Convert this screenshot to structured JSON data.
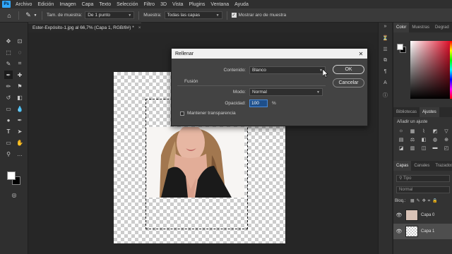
{
  "menubar": {
    "logo": "Ps",
    "items": [
      "Archivo",
      "Edición",
      "Imagen",
      "Capa",
      "Texto",
      "Selección",
      "Filtro",
      "3D",
      "Vista",
      "Plugins",
      "Ventana",
      "Ayuda"
    ]
  },
  "options": {
    "sample_size_label": "Tam. de muestra:",
    "sample_size_value": "De 1 punto",
    "sample_label": "Muestra:",
    "sample_value": "Todas las capas",
    "show_ring_label": "Mostrar aro de muestra",
    "show_ring_checked": true
  },
  "document": {
    "tab_title": "Ester-Expósito-1.jpg al 66,7% (Capa 1, RGB/8#) *",
    "close": "×"
  },
  "dialog": {
    "title": "Rellenar",
    "close": "✕",
    "contents_label": "Contenido:",
    "contents_value": "Blanco",
    "ok_label": "OK",
    "cancel_label": "Cancelar",
    "blending_title": "Fusión",
    "mode_label": "Modo:",
    "mode_value": "Normal",
    "opacity_label": "Opacidad:",
    "opacity_value": "100",
    "opacity_unit": "%",
    "preserve_transparency_label": "Mantener transparencia"
  },
  "right_panel": {
    "color_tabs": [
      "Color",
      "Muestras",
      "Degrad"
    ],
    "lib_tabs": [
      "Bibliotecas",
      "Ajustes"
    ],
    "adjust_title": "Añadir un ajuste",
    "layer_tabs": [
      "Capas",
      "Canales",
      "Trazados"
    ],
    "search_placeholder": "Tipo",
    "blend_mode": "Normal",
    "lock_label": "Bloq.:",
    "layers": [
      {
        "name": "Capa 0",
        "selected": false
      },
      {
        "name": "Capa 1",
        "selected": true
      }
    ]
  },
  "colors": {
    "accent": "#31a8ff",
    "fg_color": "#ffffff",
    "bg_color": "#000000"
  }
}
